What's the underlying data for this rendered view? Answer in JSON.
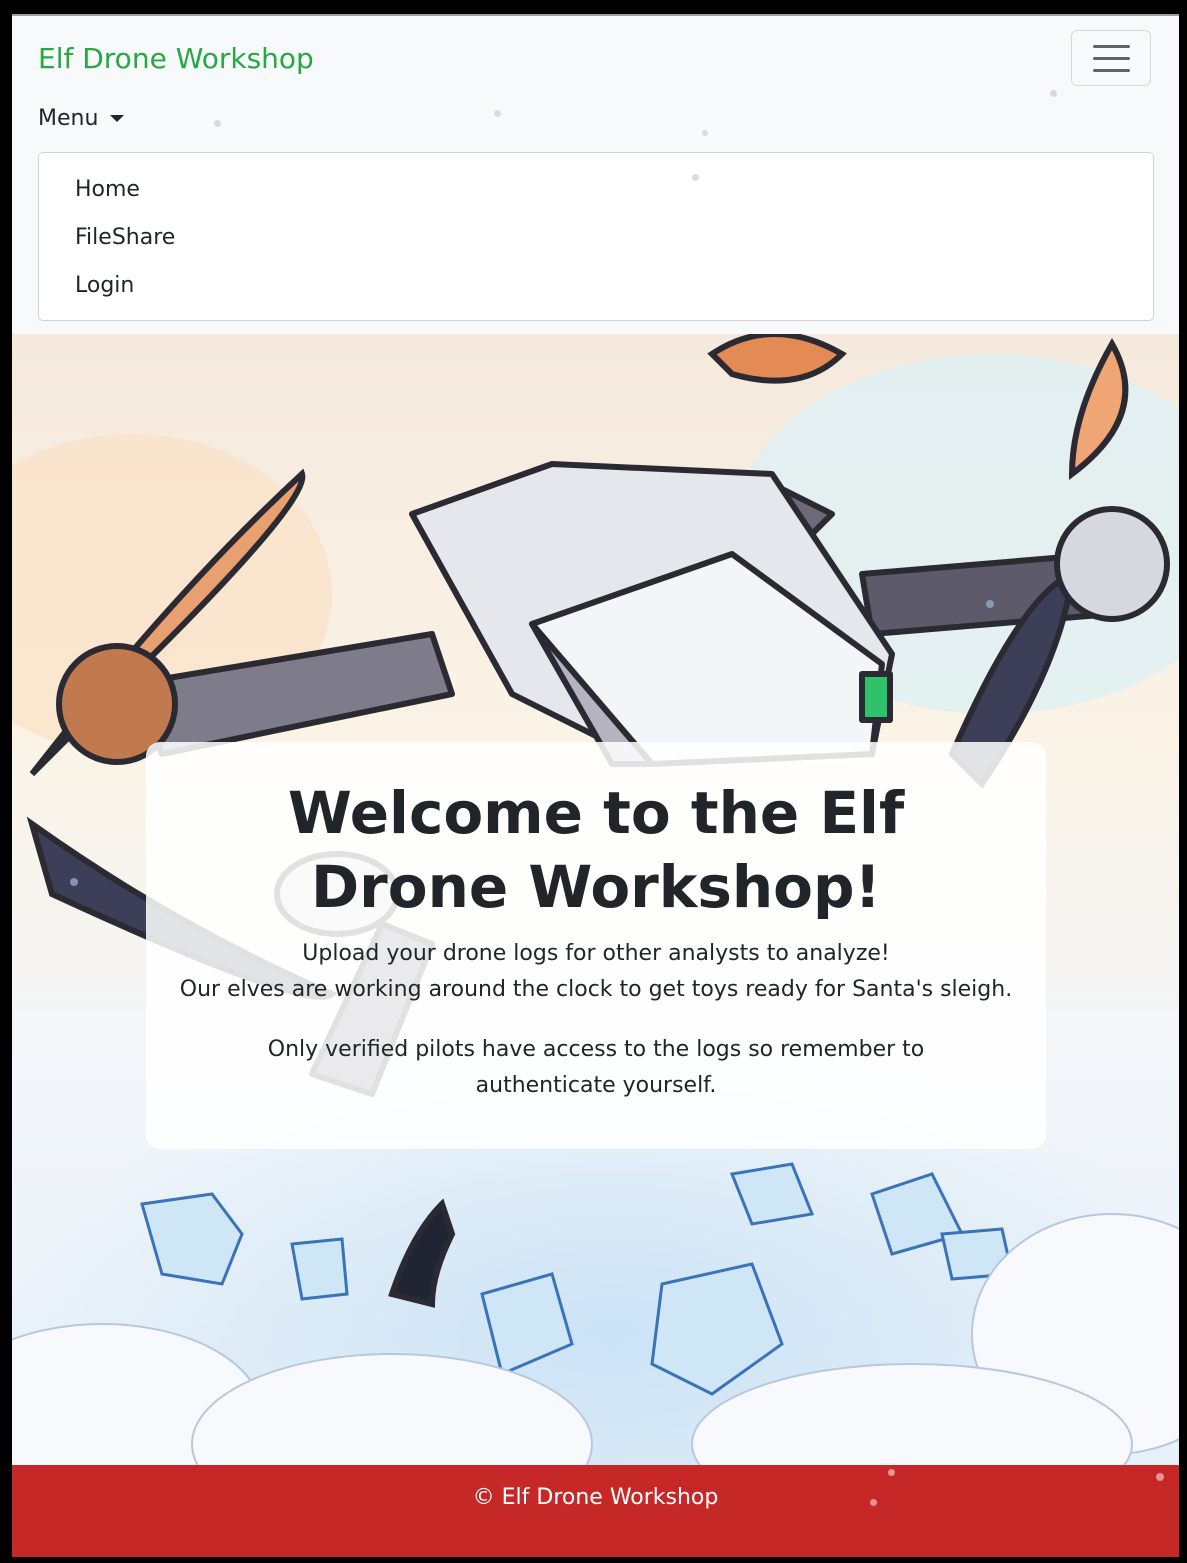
{
  "navbar": {
    "brand": "Elf Drone Workshop",
    "toggler_icon": "hamburger-icon",
    "menu_label": "Menu",
    "menu_items": [
      {
        "label": "Home"
      },
      {
        "label": "FileShare"
      },
      {
        "label": "Login"
      }
    ]
  },
  "hero": {
    "title": "Welcome to the Elf Drone Workshop!",
    "line1": "Upload your drone logs for other analysts to analyze!",
    "line2": "Our elves are working around the clock to get toys ready for Santa's sleigh.",
    "line3": "Only verified pilots have access to the logs so remember to authenticate yourself."
  },
  "footer": {
    "text": "© Elf Drone Workshop"
  },
  "colors": {
    "brand": "#28a745",
    "footer": "#c62828",
    "navbar_bg": "#f8f9fa"
  }
}
